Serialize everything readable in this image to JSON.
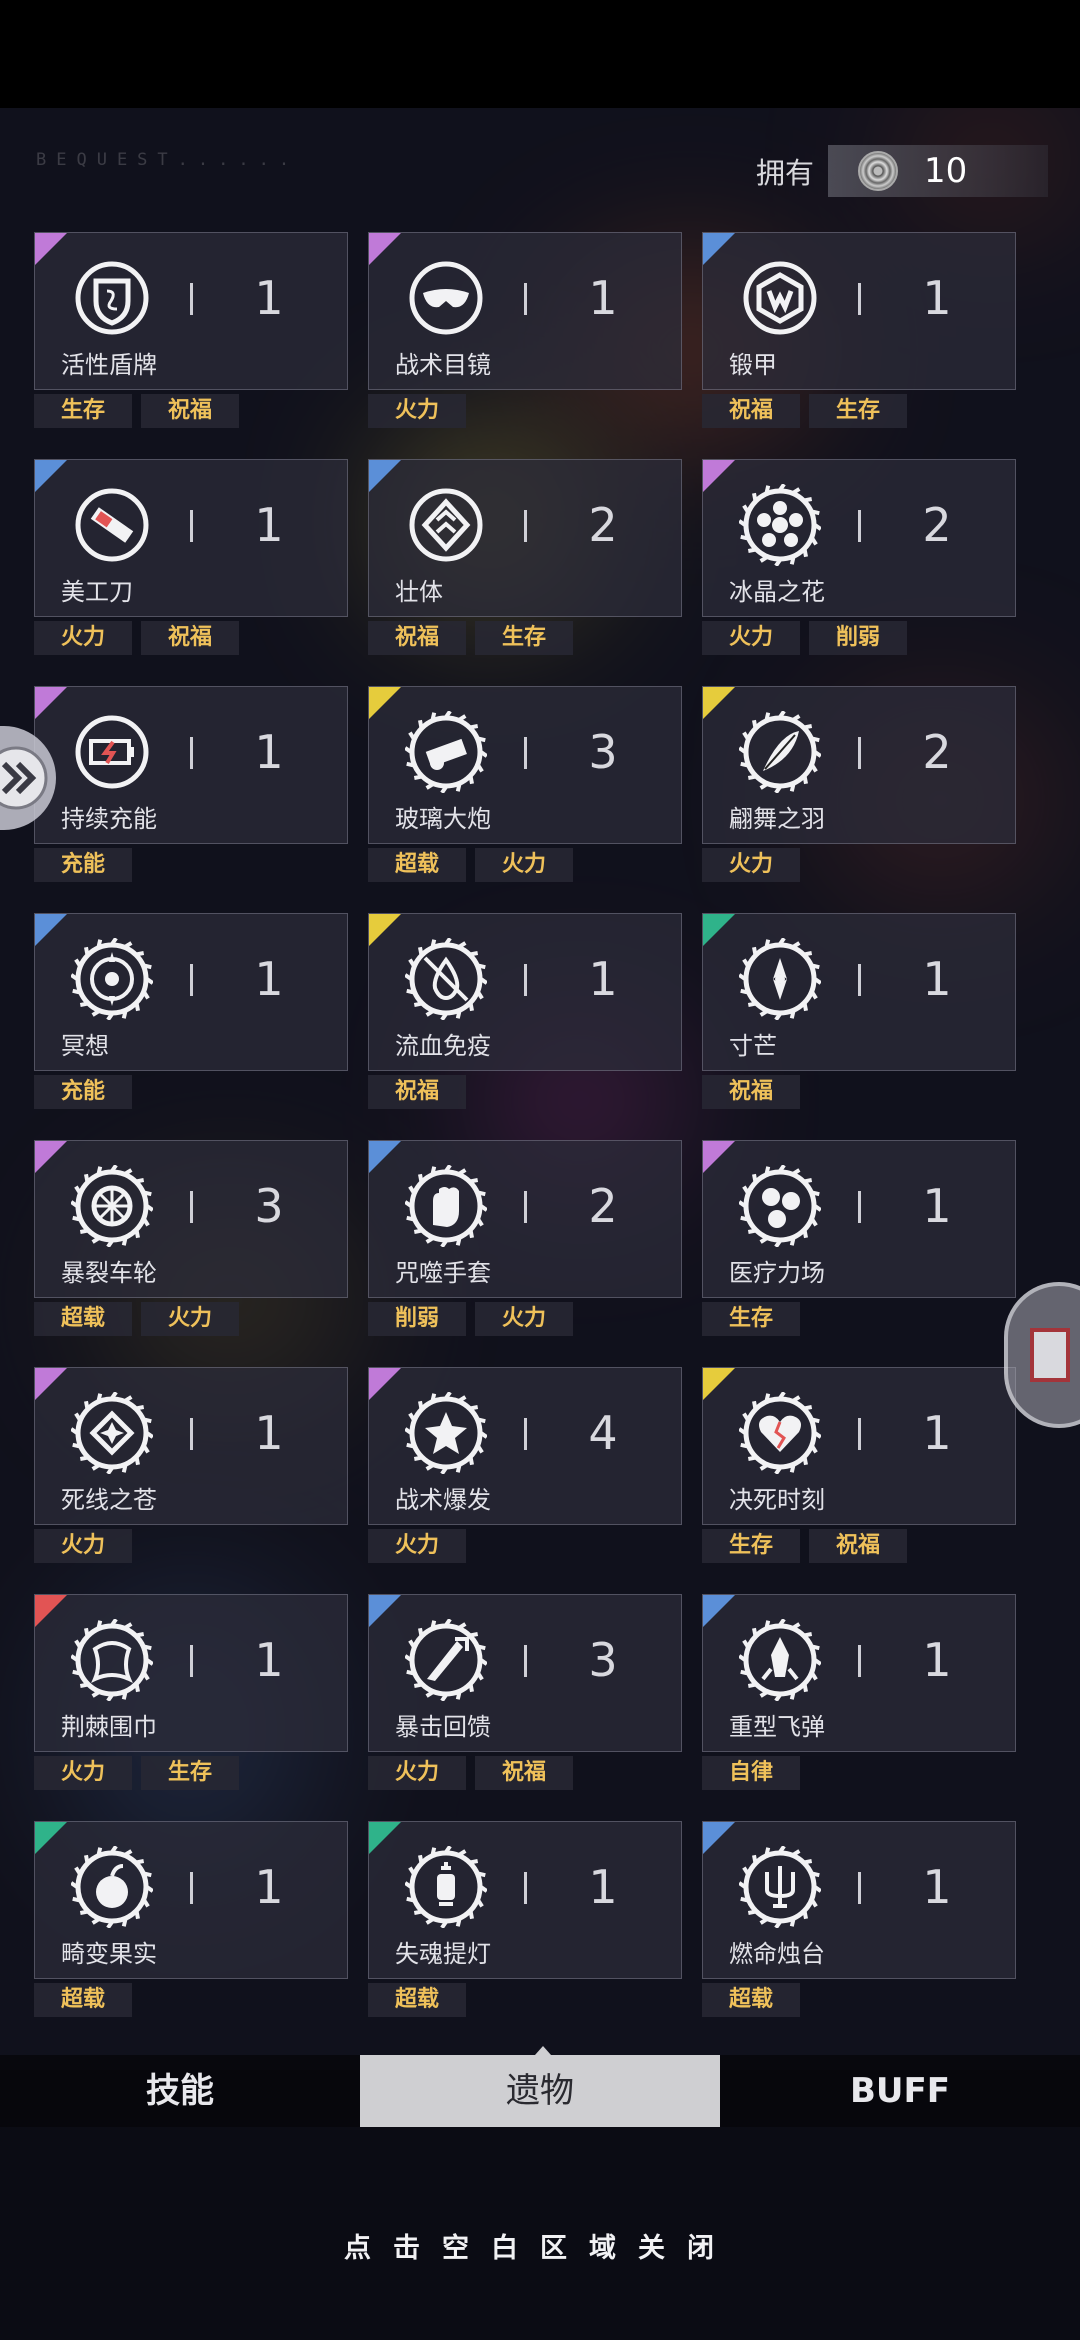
{
  "header": {
    "bequest": "BEQUEST......",
    "own_label": "拥有",
    "own_count": "10"
  },
  "colors": {
    "purple": "#c07ad8",
    "blue": "#5b8fd8",
    "yellow": "#e6cc3c",
    "green": "#2fb38a",
    "red": "#e25454",
    "tag_text": "#efc15a"
  },
  "relics": [
    {
      "name": "活性盾牌",
      "count": "1",
      "rarity": "purple",
      "icon": "shield-icon",
      "tags": [
        "生存",
        "祝福"
      ]
    },
    {
      "name": "战术目镜",
      "count": "1",
      "rarity": "purple",
      "icon": "goggles-icon",
      "tags": [
        "火力"
      ]
    },
    {
      "name": "锻甲",
      "count": "1",
      "rarity": "blue",
      "icon": "armor-icon",
      "tags": [
        "祝福",
        "生存"
      ]
    },
    {
      "name": "美工刀",
      "count": "1",
      "rarity": "blue",
      "icon": "box-cutter-icon",
      "tags": [
        "火力",
        "祝福"
      ]
    },
    {
      "name": "壮体",
      "count": "2",
      "rarity": "blue",
      "icon": "diamond-chevron-icon",
      "tags": [
        "祝福",
        "生存"
      ]
    },
    {
      "name": "冰晶之花",
      "count": "2",
      "rarity": "purple",
      "icon": "ice-flower-icon",
      "tags": [
        "火力",
        "削弱"
      ]
    },
    {
      "name": "持续充能",
      "count": "1",
      "rarity": "purple",
      "icon": "battery-icon",
      "tags": [
        "充能"
      ]
    },
    {
      "name": "玻璃大炮",
      "count": "3",
      "rarity": "yellow",
      "icon": "cannon-icon",
      "tags": [
        "超载",
        "火力"
      ]
    },
    {
      "name": "翩舞之羽",
      "count": "2",
      "rarity": "yellow",
      "icon": "feather-icon",
      "tags": [
        "火力"
      ]
    },
    {
      "name": "冥想",
      "count": "1",
      "rarity": "blue",
      "icon": "meditation-icon",
      "tags": [
        "充能"
      ]
    },
    {
      "name": "流血免疫",
      "count": "1",
      "rarity": "yellow",
      "icon": "blood-immune-icon",
      "tags": [
        "祝福"
      ]
    },
    {
      "name": "寸芒",
      "count": "1",
      "rarity": "green",
      "icon": "spike-icon",
      "tags": [
        "祝福"
      ]
    },
    {
      "name": "暴裂车轮",
      "count": "3",
      "rarity": "purple",
      "icon": "wheel-icon",
      "tags": [
        "超载",
        "火力"
      ]
    },
    {
      "name": "咒噬手套",
      "count": "2",
      "rarity": "blue",
      "icon": "glove-icon",
      "tags": [
        "削弱",
        "火力"
      ]
    },
    {
      "name": "医疗力场",
      "count": "1",
      "rarity": "purple",
      "icon": "medical-field-icon",
      "tags": [
        "生存"
      ]
    },
    {
      "name": "死线之苍",
      "count": "1",
      "rarity": "purple",
      "icon": "deadline-icon",
      "tags": [
        "火力"
      ]
    },
    {
      "name": "战术爆发",
      "count": "4",
      "rarity": "purple",
      "icon": "burst-icon",
      "tags": [
        "火力"
      ]
    },
    {
      "name": "决死时刻",
      "count": "1",
      "rarity": "yellow",
      "icon": "heart-crack-icon",
      "tags": [
        "生存",
        "祝福"
      ]
    },
    {
      "name": "荆棘围巾",
      "count": "1",
      "rarity": "red",
      "icon": "thorn-scarf-icon",
      "tags": [
        "火力",
        "生存"
      ]
    },
    {
      "name": "暴击回馈",
      "count": "3",
      "rarity": "blue",
      "icon": "crit-feedback-icon",
      "tags": [
        "火力",
        "祝福"
      ]
    },
    {
      "name": "重型飞弹",
      "count": "1",
      "rarity": "blue",
      "icon": "missile-icon",
      "tags": [
        "自律"
      ]
    },
    {
      "name": "畸变果实",
      "count": "1",
      "rarity": "green",
      "icon": "fruit-icon",
      "tags": [
        "超载"
      ]
    },
    {
      "name": "失魂提灯",
      "count": "1",
      "rarity": "green",
      "icon": "lantern-icon",
      "tags": [
        "超载"
      ]
    },
    {
      "name": "燃命烛台",
      "count": "1",
      "rarity": "blue",
      "icon": "candelabra-icon",
      "tags": [
        "超载"
      ]
    }
  ],
  "tabs": [
    {
      "label": "技能",
      "active": false
    },
    {
      "label": "遗物",
      "active": true
    },
    {
      "label": "BUFF",
      "active": false
    }
  ],
  "footer": {
    "close_hint": "点击空白区域关闭"
  }
}
